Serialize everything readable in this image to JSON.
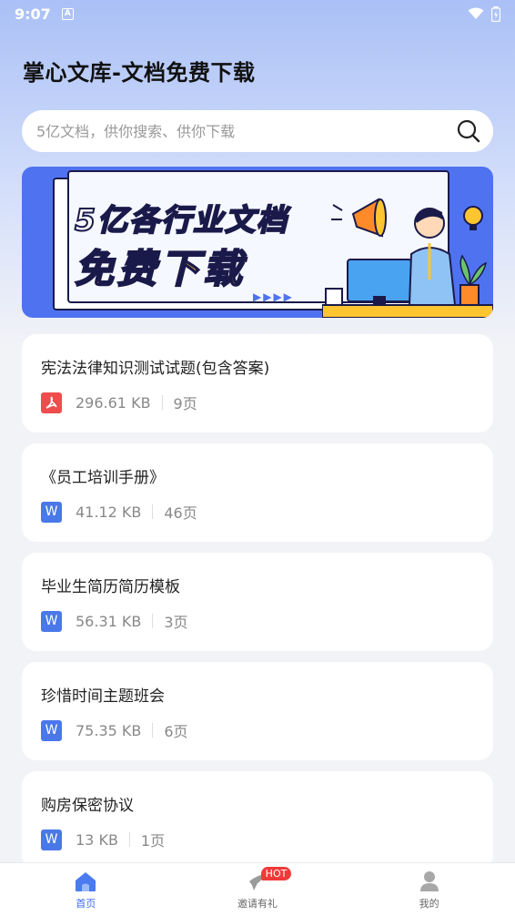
{
  "status_bar": {
    "time": "9:07"
  },
  "app_title": "掌心文库-文档免费下载",
  "search": {
    "placeholder": "5亿文档，供你搜索、供你下载"
  },
  "banner": {
    "line1": "5亿各行业文档",
    "line2": "免费下载"
  },
  "documents": [
    {
      "title": "宪法法律知识测试试题(包含答案)",
      "type": "pdf",
      "size": "296.61 KB",
      "pages": "9页"
    },
    {
      "title": "《员工培训手册》",
      "type": "word",
      "size": "41.12 KB",
      "pages": "46页"
    },
    {
      "title": "毕业生简历简历模板",
      "type": "word",
      "size": "56.31 KB",
      "pages": "3页"
    },
    {
      "title": "珍惜时间主题班会",
      "type": "word",
      "size": "75.35 KB",
      "pages": "6页"
    },
    {
      "title": "购房保密协议",
      "type": "word",
      "size": "13 KB",
      "pages": "1页"
    }
  ],
  "icons": {
    "pdf": "acrobat-icon",
    "word": "W"
  },
  "colors": {
    "accent": "#3b6cf0",
    "pdf": "#ee4d4d",
    "word": "#4a78e8",
    "hot": "#f03a3a"
  },
  "nav": {
    "home": "首页",
    "invite": "邀请有礼",
    "invite_badge": "HOT",
    "mine": "我的"
  }
}
